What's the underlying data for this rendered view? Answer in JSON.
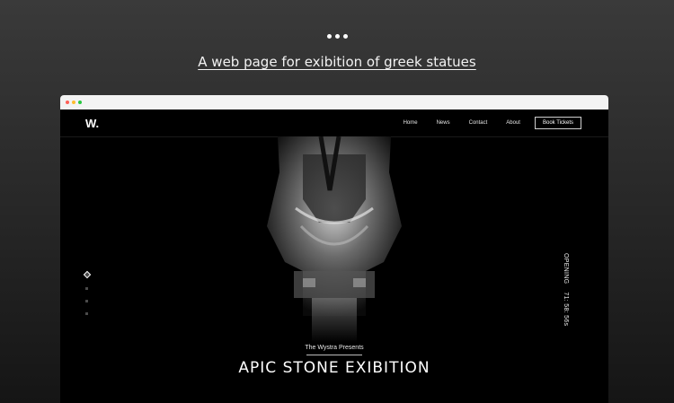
{
  "caption": "A web page for exibition of greek statues",
  "colors": {
    "background": "#2b2b2b",
    "site_bg": "#000000",
    "window_red": "#ff5f57",
    "window_yellow": "#febc2e",
    "window_green": "#28c840"
  },
  "site": {
    "logo": "W.",
    "nav": [
      "Home",
      "News",
      "Contact",
      "About"
    ],
    "cta": "Book Tickets",
    "opening_label": "OPENING",
    "countdown": "71: 58: 56s",
    "presents": "The Wystra Presents",
    "title": "APIC STONE EXIBITION",
    "pager": {
      "count": 4,
      "active": 1
    }
  }
}
